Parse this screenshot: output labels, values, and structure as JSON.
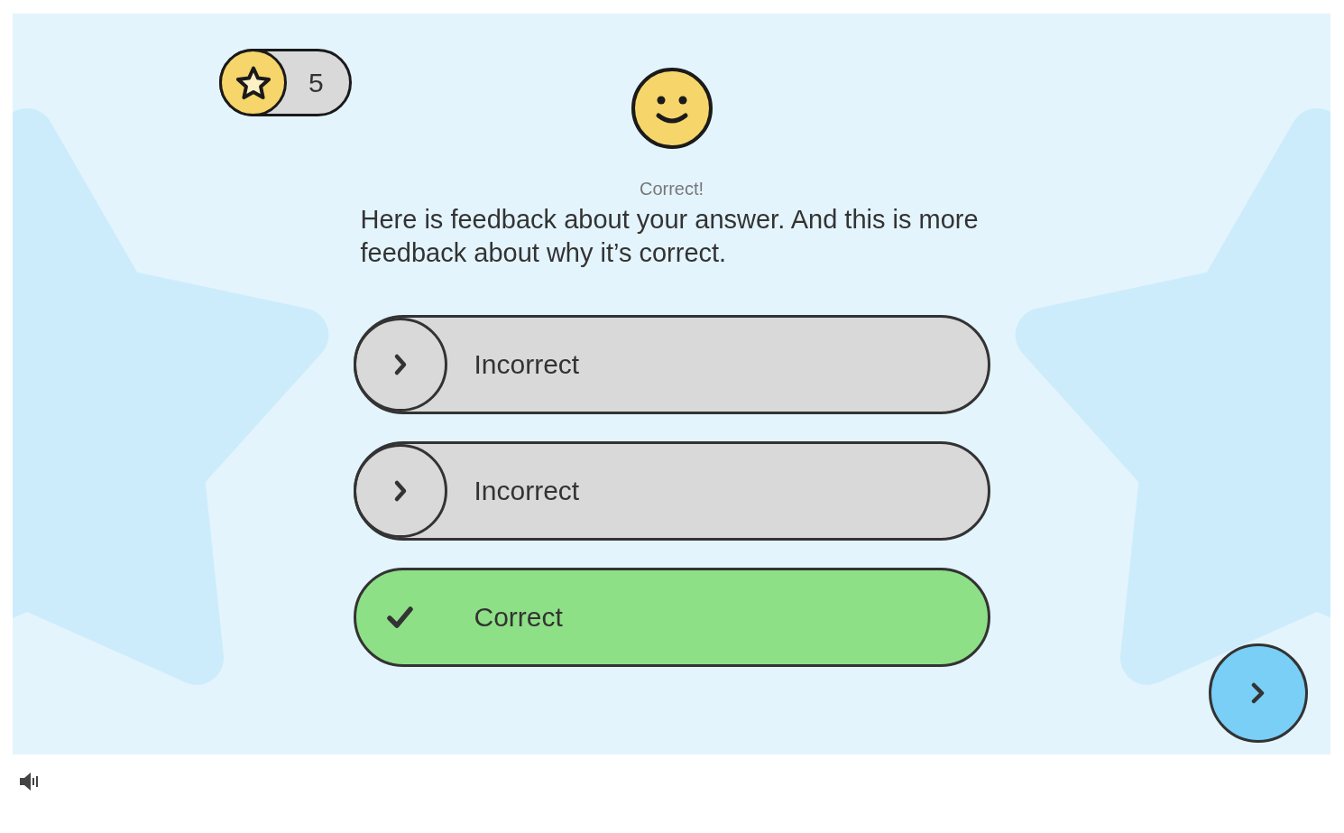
{
  "score": {
    "count": "5"
  },
  "feedback": {
    "heading": "Correct!",
    "text": "Here is feedback about your answer. And this is more feedback about why it’s correct."
  },
  "options": [
    {
      "label": "Incorrect",
      "kind": "incorrect",
      "selected": false
    },
    {
      "label": "Incorrect",
      "kind": "incorrect",
      "selected": false
    },
    {
      "label": "Correct",
      "kind": "correct",
      "selected": true
    }
  ]
}
